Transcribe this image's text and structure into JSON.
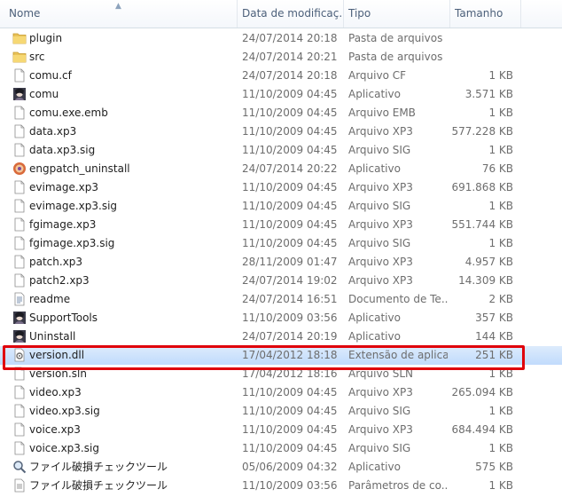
{
  "header": {
    "name": "Nome",
    "date": "Data de modificaç...",
    "type": "Tipo",
    "size": "Tamanho"
  },
  "files": [
    {
      "name": "plugin",
      "date": "24/07/2014 20:18",
      "type": "Pasta de arquivos",
      "size": "",
      "icon": "folder-icon"
    },
    {
      "name": "src",
      "date": "24/07/2014 20:21",
      "type": "Pasta de arquivos",
      "size": "",
      "icon": "folder-icon"
    },
    {
      "name": "comu.cf",
      "date": "24/07/2014 20:18",
      "type": "Arquivo CF",
      "size": "1 KB",
      "icon": "file-icon"
    },
    {
      "name": "comu",
      "date": "11/10/2009 04:45",
      "type": "Aplicativo",
      "size": "3.571 KB",
      "icon": "app-icon"
    },
    {
      "name": "comu.exe.emb",
      "date": "11/10/2009 04:45",
      "type": "Arquivo EMB",
      "size": "1 KB",
      "icon": "file-icon"
    },
    {
      "name": "data.xp3",
      "date": "11/10/2009 04:45",
      "type": "Arquivo XP3",
      "size": "577.228 KB",
      "icon": "file-icon"
    },
    {
      "name": "data.xp3.sig",
      "date": "11/10/2009 04:45",
      "type": "Arquivo SIG",
      "size": "1 KB",
      "icon": "file-icon"
    },
    {
      "name": "engpatch_uninstall",
      "date": "24/07/2014 20:22",
      "type": "Aplicativo",
      "size": "76 KB",
      "icon": "uninstall-app-icon"
    },
    {
      "name": "evimage.xp3",
      "date": "11/10/2009 04:45",
      "type": "Arquivo XP3",
      "size": "691.868 KB",
      "icon": "file-icon"
    },
    {
      "name": "evimage.xp3.sig",
      "date": "11/10/2009 04:45",
      "type": "Arquivo SIG",
      "size": "1 KB",
      "icon": "file-icon"
    },
    {
      "name": "fgimage.xp3",
      "date": "11/10/2009 04:45",
      "type": "Arquivo XP3",
      "size": "551.744 KB",
      "icon": "file-icon"
    },
    {
      "name": "fgimage.xp3.sig",
      "date": "11/10/2009 04:45",
      "type": "Arquivo SIG",
      "size": "1 KB",
      "icon": "file-icon"
    },
    {
      "name": "patch.xp3",
      "date": "28/11/2009 01:47",
      "type": "Arquivo XP3",
      "size": "4.957 KB",
      "icon": "file-icon"
    },
    {
      "name": "patch2.xp3",
      "date": "24/07/2014 19:02",
      "type": "Arquivo XP3",
      "size": "14.309 KB",
      "icon": "file-icon"
    },
    {
      "name": "readme",
      "date": "24/07/2014 16:51",
      "type": "Documento de Te...",
      "size": "2 KB",
      "icon": "text-document-icon"
    },
    {
      "name": "SupportTools",
      "date": "11/10/2009 03:56",
      "type": "Aplicativo",
      "size": "357 KB",
      "icon": "app-icon"
    },
    {
      "name": "Uninstall",
      "date": "24/07/2014 20:19",
      "type": "Aplicativo",
      "size": "144 KB",
      "icon": "app-icon"
    },
    {
      "name": "version.dll",
      "date": "17/04/2012 18:18",
      "type": "Extensão de aplica...",
      "size": "251 KB",
      "icon": "dll-gear-icon",
      "selected": true
    },
    {
      "name": "version.sln",
      "date": "17/04/2012 18:16",
      "type": "Arquivo SLN",
      "size": "1 KB",
      "icon": "file-icon"
    },
    {
      "name": "video.xp3",
      "date": "11/10/2009 04:45",
      "type": "Arquivo XP3",
      "size": "265.094 KB",
      "icon": "file-icon"
    },
    {
      "name": "video.xp3.sig",
      "date": "11/10/2009 04:45",
      "type": "Arquivo SIG",
      "size": "1 KB",
      "icon": "file-icon"
    },
    {
      "name": "voice.xp3",
      "date": "11/10/2009 04:45",
      "type": "Arquivo XP3",
      "size": "684.494 KB",
      "icon": "file-icon"
    },
    {
      "name": "voice.xp3.sig",
      "date": "11/10/2009 04:45",
      "type": "Arquivo SIG",
      "size": "1 KB",
      "icon": "file-icon"
    },
    {
      "name": "ファイル破損チェックツール",
      "date": "05/06/2009 04:32",
      "type": "Aplicativo",
      "size": "575 KB",
      "icon": "magnifier-app-icon"
    },
    {
      "name": "ファイル破損チェックツール",
      "date": "11/10/2009 03:56",
      "type": "Parâmetros de co...",
      "size": "1 KB",
      "icon": "settings-file-icon"
    }
  ],
  "colors": {
    "highlight_border": "#e0000b",
    "selected_row": "#c1dbfc",
    "folder": "#e8c25a"
  }
}
